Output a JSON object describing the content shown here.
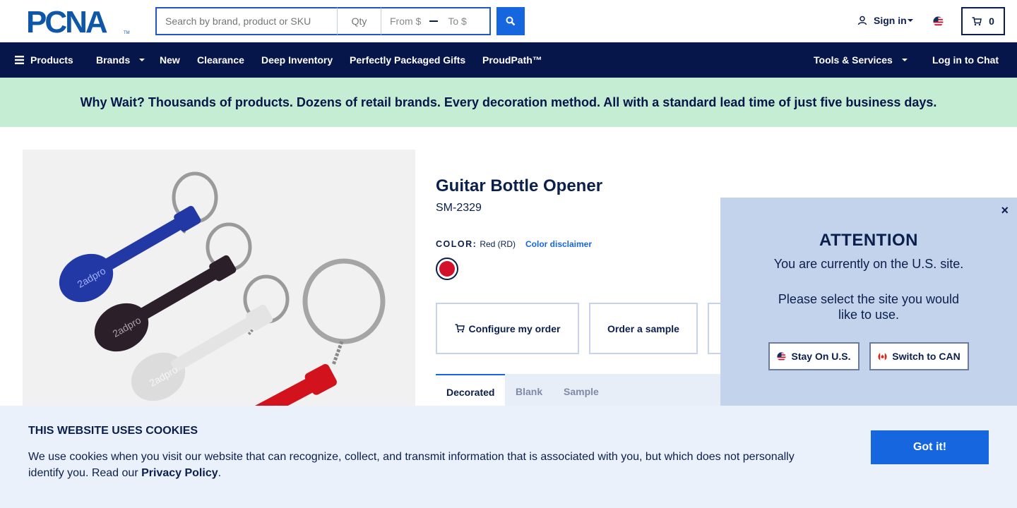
{
  "header": {
    "logo_text": "PCNA",
    "search_placeholder": "Search by brand, product or SKU",
    "qty_placeholder": "Qty",
    "price_from_placeholder": "From $",
    "price_to_placeholder": "To $",
    "search_icon": "search-icon",
    "signin_label": "Sign in",
    "cart_count": "0",
    "accent_color": "#1666e0"
  },
  "nav": {
    "products": "Products",
    "brands": "Brands",
    "new": "New",
    "clearance": "Clearance",
    "deep_inventory": "Deep Inventory",
    "gifts": "Perfectly Packaged Gifts",
    "proudpath": "ProudPath™",
    "tools": "Tools & Services",
    "chat": "Log in to Chat",
    "background": "#07164a"
  },
  "banner": {
    "text": "Why Wait? Thousands of products. Dozens of retail brands. Every decoration method. All with a standard lead time of just five business days.",
    "background": "#c4edd3"
  },
  "product": {
    "title": "Guitar Bottle Opener",
    "sku": "SM-2329",
    "color_label": "COLOR:",
    "color_value": "Red (RD)",
    "color_disclaimer": "Color disclaimer",
    "swatch_color": "#d4112d",
    "image_imprint": "2adpro",
    "actions": {
      "configure": "Configure my order",
      "sample": "Order a sample"
    },
    "tabs": [
      "Decorated",
      "Blank",
      "Sample"
    ]
  },
  "attention": {
    "title": "ATTENTION",
    "line1": "You are currently on the U.S. site.",
    "line2": "Please select the site you would like to use.",
    "stay_label": "Stay On U.S.",
    "switch_label": "Switch to CAN",
    "close": "×"
  },
  "cookie": {
    "title": "THIS WEBSITE USES COOKIES",
    "text": "We use cookies when you visit our website that can recognize, collect, and transmit information that is associated with you, but which does not personally identify you. Read our ",
    "link": "Privacy Policy",
    "suffix": ".",
    "button": "Got it!"
  }
}
